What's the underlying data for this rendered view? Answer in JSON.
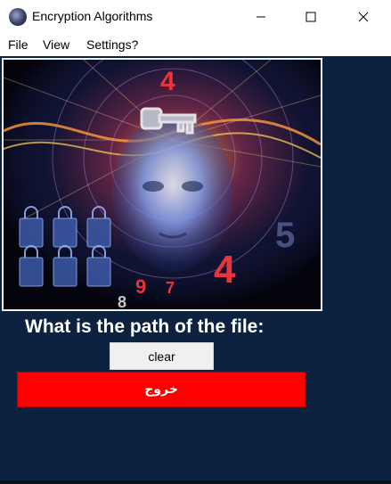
{
  "window": {
    "title": "Encryption Algorithms",
    "icon": "app-globe-icon",
    "controls": [
      "minimize-icon",
      "maximize-icon",
      "close-icon"
    ]
  },
  "menu": {
    "items": [
      {
        "label": "File"
      },
      {
        "label": "View"
      },
      {
        "label": "Settings?"
      }
    ]
  },
  "main": {
    "image": {
      "subject": "digital head with key and padlocks",
      "glyphs": [
        "4",
        "5",
        "4",
        "9",
        "7",
        "8"
      ]
    },
    "prompt": "What is the path of the file:",
    "clear_button": "clear",
    "exit_button": "خروج"
  },
  "colors": {
    "background": "#0d2240",
    "exit_button": "#ff0000",
    "clear_button": "#f0f0f0",
    "prompt_text": "#ffffff"
  }
}
